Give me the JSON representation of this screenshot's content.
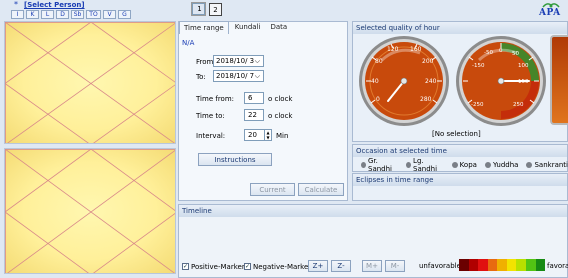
{
  "header": {
    "person_link": "[Select Person]",
    "star_icon": "*",
    "mini_tabs": [
      "I",
      "K",
      "L",
      "D",
      "Sb",
      "TO",
      "V",
      "G"
    ],
    "chart_buttons": [
      "1",
      "2"
    ],
    "logo_text": "APA"
  },
  "left_panel": {
    "tabs": [
      "Time range",
      "Kundali",
      "Data"
    ],
    "status": "N/A",
    "from_label": "From:",
    "from_value": "2018/10/  3",
    "to_label": "To:",
    "to_value": "2018/10/  7",
    "time_from_label": "Time from:",
    "time_from_value": "6",
    "time_to_label": "Time to:",
    "time_to_value": "22",
    "oclock": "o clock",
    "interval_label": "Interval:",
    "interval_value": "20",
    "min_label": "Min",
    "instructions_button": "Instructions",
    "current_button": "Current",
    "calculate_button": "Calculate"
  },
  "quality_panel": {
    "title": "Selected quality of hour",
    "gauge1_ticks": [
      "0",
      "40",
      "80",
      "120",
      "160",
      "200",
      "240",
      "280"
    ],
    "gauge2_ticks": [
      "-250",
      "-150",
      "-50",
      "0",
      "50",
      "100",
      "150",
      "250"
    ],
    "no_selection": "[No selection]"
  },
  "occasion_panel": {
    "title": "Occasion at selected time",
    "items": [
      "Gr. Sandhi",
      "Lg. Sandhi",
      "Kopa",
      "Yuddha",
      "Sankranti"
    ]
  },
  "eclipses_panel": {
    "title": "Eclipses in time range"
  },
  "timeline": {
    "title": "Timeline",
    "positive_marker": "Positive-Marker",
    "negative_marker": "Negative-Marker",
    "zoom_in": "Z+",
    "zoom_out": "Z-",
    "m_plus": "M+",
    "m_minus": "M-",
    "unfavorable": "unfavorable",
    "favorable": "favorab",
    "scale_colors": [
      "#6b0000",
      "#b00000",
      "#e11010",
      "#e86a10",
      "#f0b000",
      "#f3e300",
      "#b8e000",
      "#52c414",
      "#178a14"
    ]
  }
}
